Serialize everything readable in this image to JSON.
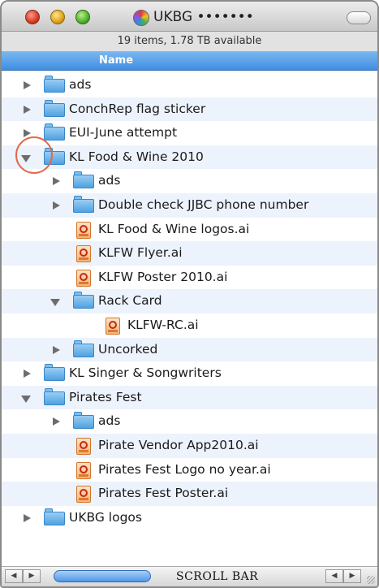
{
  "window": {
    "title": "UKBG •••••••",
    "status_text": "19 items, 1.78 TB available",
    "column_header": "Name"
  },
  "rows": [
    {
      "label": "ads",
      "type": "folder",
      "depth": 0,
      "disclosure": "collapsed"
    },
    {
      "label": "ConchRep flag sticker",
      "type": "folder",
      "depth": 0,
      "disclosure": "collapsed"
    },
    {
      "label": "EUI-June attempt",
      "type": "folder",
      "depth": 0,
      "disclosure": "collapsed"
    },
    {
      "label": "KL Food & Wine 2010",
      "type": "folder",
      "depth": 0,
      "disclosure": "expanded"
    },
    {
      "label": "ads",
      "type": "folder",
      "depth": 1,
      "disclosure": "collapsed"
    },
    {
      "label": "Double check JJBC phone number",
      "type": "folder",
      "depth": 1,
      "disclosure": "collapsed"
    },
    {
      "label": "KL Food & Wine logos.ai",
      "type": "ai-file",
      "depth": 1,
      "disclosure": "none"
    },
    {
      "label": "KLFW Flyer.ai",
      "type": "ai-file",
      "depth": 1,
      "disclosure": "none"
    },
    {
      "label": "KLFW Poster 2010.ai",
      "type": "ai-file",
      "depth": 1,
      "disclosure": "none"
    },
    {
      "label": "Rack Card",
      "type": "folder",
      "depth": 1,
      "disclosure": "expanded"
    },
    {
      "label": "KLFW-RC.ai",
      "type": "ai-file",
      "depth": 2,
      "disclosure": "none"
    },
    {
      "label": "Uncorked",
      "type": "folder",
      "depth": 1,
      "disclosure": "collapsed"
    },
    {
      "label": "KL Singer & Songwriters",
      "type": "folder",
      "depth": 0,
      "disclosure": "collapsed"
    },
    {
      "label": "Pirates Fest",
      "type": "folder",
      "depth": 0,
      "disclosure": "expanded"
    },
    {
      "label": "ads",
      "type": "folder",
      "depth": 1,
      "disclosure": "collapsed"
    },
    {
      "label": "Pirate Vendor App2010.ai",
      "type": "ai-file",
      "depth": 1,
      "disclosure": "none"
    },
    {
      "label": "Pirates Fest Logo no year.ai",
      "type": "ai-file",
      "depth": 1,
      "disclosure": "none"
    },
    {
      "label": "Pirates Fest Poster.ai",
      "type": "ai-file",
      "depth": 1,
      "disclosure": "none"
    },
    {
      "label": "UKBG logos",
      "type": "folder",
      "depth": 0,
      "disclosure": "collapsed"
    }
  ],
  "scrollbar": {
    "label": "SCROLL BAR"
  },
  "colors": {
    "header_blue": "#3f8ee0",
    "row_alt": "#edf3fd",
    "highlight_circle": "#e06a4a"
  },
  "icons": {
    "close": "close-icon",
    "minimize": "minimize-icon",
    "zoom": "zoom-icon",
    "folder": "folder-icon",
    "ai_file": "illustrator-file-icon",
    "disclosure": "disclosure-triangle-icon"
  }
}
